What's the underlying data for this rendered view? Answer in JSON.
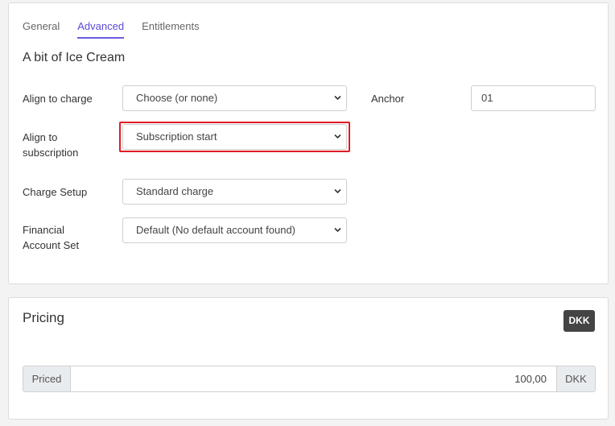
{
  "tabs": [
    {
      "label": "General",
      "active": false
    },
    {
      "label": "Advanced",
      "active": true
    },
    {
      "label": "Entitlements",
      "active": false
    }
  ],
  "product_title": "A bit of Ice Cream",
  "form": {
    "align_to_charge": {
      "label": "Align to charge",
      "value": "Choose (or none)"
    },
    "anchor": {
      "label": "Anchor",
      "value": "01"
    },
    "align_to_subscription": {
      "label_line1": "Align to",
      "label_line2": "subscription",
      "value": "Subscription start"
    },
    "charge_setup": {
      "label": "Charge Setup",
      "value": "Standard charge"
    },
    "financial_account_set": {
      "label_line1": "Financial",
      "label_line2": "Account Set",
      "value": "Default (No default account found)"
    }
  },
  "pricing": {
    "title": "Pricing",
    "currency_badge": "DKK",
    "addon_left": "Priced",
    "price_value": "100,00",
    "addon_right": "DKK"
  },
  "colors": {
    "accent": "#6a5ae0",
    "highlight": "#e01b24",
    "badge_bg": "#444444"
  }
}
